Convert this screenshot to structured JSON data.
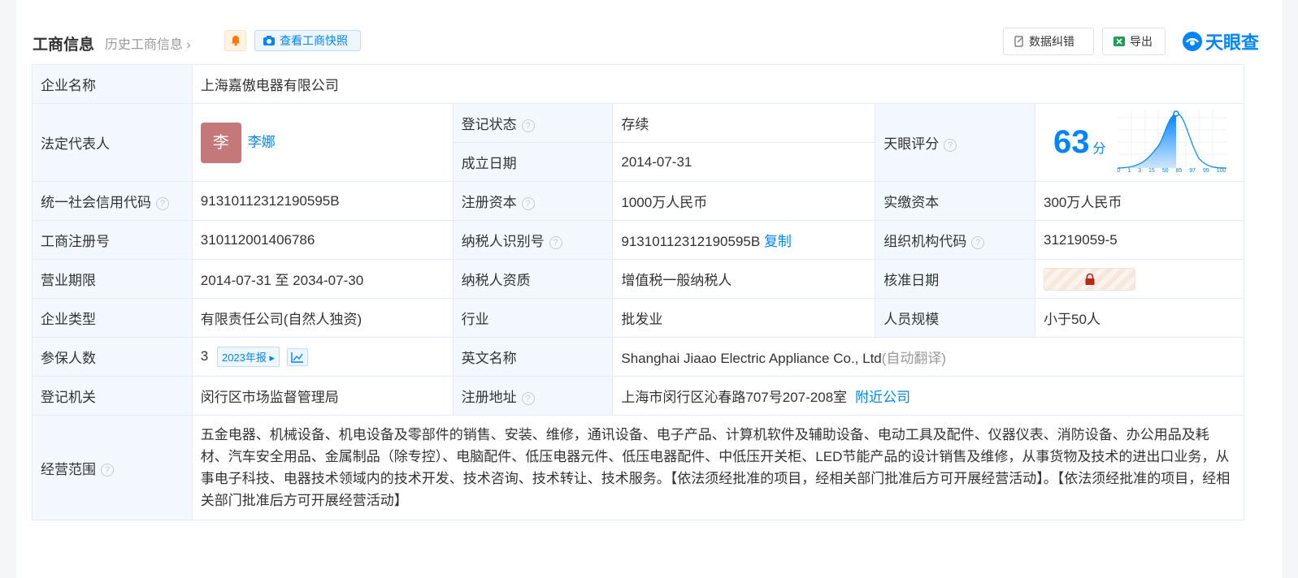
{
  "header": {
    "title": "工商信息",
    "history_link": "历史工商信息",
    "snapshot_btn": "查看工商快照",
    "correct_btn": "数据纠错",
    "export_btn": "导出",
    "logo_text": "天眼查"
  },
  "colors": {
    "accent": "#0084ff",
    "label_bg": "#f2f8fe",
    "status_green": "#00a854",
    "avatar_bg": "#c4787a"
  },
  "company": {
    "name_label": "企业名称",
    "name": "上海嘉傲电器有限公司",
    "legal_label": "法定代表人",
    "legal_avatar": "李",
    "legal_name": "李娜",
    "status_label": "登记状态",
    "status": "存续",
    "est_label": "成立日期",
    "est_date": "2014-07-31",
    "score_label": "天眼评分",
    "score": "63",
    "score_unit": "分",
    "score_ticks": [
      "0",
      "1",
      "3",
      "15",
      "50",
      "85",
      "97",
      "99",
      "100"
    ],
    "credit_label": "统一社会信用代码",
    "credit_code": "91310112312190595B",
    "capital_label": "注册资本",
    "capital": "1000万人民币",
    "paid_label": "实缴资本",
    "paid": "300万人民币",
    "reg_label": "工商注册号",
    "reg_no": "310112001406786",
    "tax_label": "纳税人识别号",
    "tax_no": "91310112312190595B",
    "copy": "复制",
    "org_label": "组织机构代码",
    "org_code": "31219059-5",
    "term_label": "营业期限",
    "term": "2014-07-31 至 2034-07-30",
    "taxq_label": "纳税人资质",
    "taxq": "增值税一般纳税人",
    "approve_label": "核准日期",
    "type_label": "企业类型",
    "type": "有限责任公司(自然人独资)",
    "industry_label": "行业",
    "industry": "批发业",
    "size_label": "人员规模",
    "size": "小于50人",
    "insured_label": "参保人数",
    "insured": "3",
    "insured_tag": "2023年报",
    "en_label": "英文名称",
    "en_name": "Shanghai Jiaao Electric Appliance Co., Ltd",
    "en_note": "(自动翻译)",
    "authority_label": "登记机关",
    "authority": "闵行区市场监督管理局",
    "addr_label": "注册地址",
    "addr": "上海市闵行区沁春路707号207-208室",
    "nearby": "附近公司",
    "scope_label": "经营范围",
    "scope": "五金电器、机械设备、机电设备及零部件的销售、安装、维修，通讯设备、电子产品、计算机软件及辅助设备、电动工具及配件、仪器仪表、消防设备、办公用品及耗材、汽车安全用品、金属制品（除专控）、电脑配件、低压电器元件、低压电器配件、中低压开关柜、LED节能产品的设计销售及维修，从事货物及技术的进出口业务，从事电子科技、电器技术领域内的技术开发、技术咨询、技术转让、技术服务。【依法须经批准的项目，经相关部门批准后方可开展经营活动】。【依法须经批准的项目，经相关部门批准后方可开展经营活动】"
  }
}
